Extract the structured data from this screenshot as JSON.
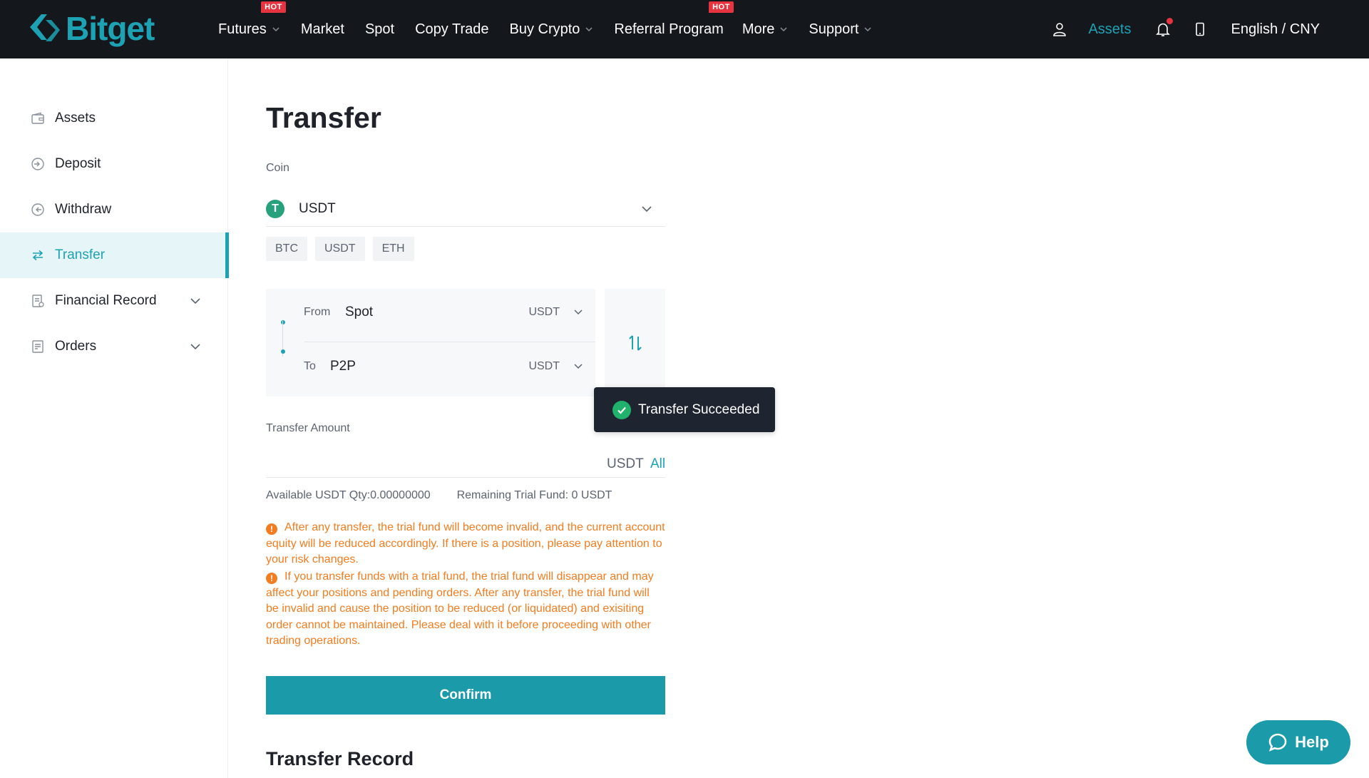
{
  "brand": {
    "name": "Bitget",
    "color": "#1da2b4"
  },
  "nav": {
    "items": [
      {
        "label": "Futures",
        "hot": true,
        "dropdown": true
      },
      {
        "label": "Market",
        "hot": false,
        "dropdown": false
      },
      {
        "label": "Spot",
        "hot": false,
        "dropdown": false
      },
      {
        "label": "Copy Trade",
        "hot": false,
        "dropdown": false
      },
      {
        "label": "Buy Crypto",
        "hot": false,
        "dropdown": true
      },
      {
        "label": "Referral Program",
        "hot": true,
        "dropdown": false
      },
      {
        "label": "More",
        "hot": false,
        "dropdown": true
      },
      {
        "label": "Support",
        "hot": false,
        "dropdown": true
      }
    ],
    "hot_label": "HOT",
    "assets_label": "Assets",
    "language": "English / CNY"
  },
  "sidebar": {
    "items": [
      {
        "label": "Assets",
        "icon": "wallet-icon",
        "active": false,
        "expandable": false
      },
      {
        "label": "Deposit",
        "icon": "deposit-icon",
        "active": false,
        "expandable": false
      },
      {
        "label": "Withdraw",
        "icon": "withdraw-icon",
        "active": false,
        "expandable": false
      },
      {
        "label": "Transfer",
        "icon": "transfer-icon",
        "active": true,
        "expandable": false
      },
      {
        "label": "Financial Record",
        "icon": "record-icon",
        "active": false,
        "expandable": true
      },
      {
        "label": "Orders",
        "icon": "orders-icon",
        "active": false,
        "expandable": true
      }
    ]
  },
  "transfer": {
    "title": "Transfer",
    "coin_label": "Coin",
    "coin_symbol_glyph": "T",
    "coin_selected": "USDT",
    "coin_chips": [
      "BTC",
      "USDT",
      "ETH"
    ],
    "from": {
      "label": "From",
      "account": "Spot",
      "coin": "USDT"
    },
    "to": {
      "label": "To",
      "account": "P2P",
      "coin": "USDT"
    },
    "amount_label": "Transfer Amount",
    "amount_value": "",
    "amount_unit": "USDT",
    "all_label": "All",
    "available": "Available USDT Qty:0.00000000",
    "remaining": "Remaining Trial Fund: 0 USDT",
    "warnings": [
      "After any transfer, the trial fund will become invalid, and the current account equity will be reduced accordingly. If there is a position, please pay attention to your risk changes.",
      "If you transfer funds with a trial fund, the trial fund will disappear and may affect your positions and pending orders. After any transfer, the trial fund will be invalid and cause the position to be reduced (or liquidated) and exisiting order cannot be maintained. Please deal with it before proceeding with other trading operations."
    ],
    "warning_glyph": "!",
    "confirm_label": "Confirm",
    "record_title": "Transfer Record"
  },
  "toast": {
    "message": "Transfer Succeeded",
    "status_color": "#20b26c"
  },
  "help": {
    "label": "Help"
  },
  "colors": {
    "accent": "#1da2b4",
    "button": "#1b9aaa",
    "warning": "#f27c1f",
    "hot": "#e5343f",
    "topbar": "#14171c"
  }
}
